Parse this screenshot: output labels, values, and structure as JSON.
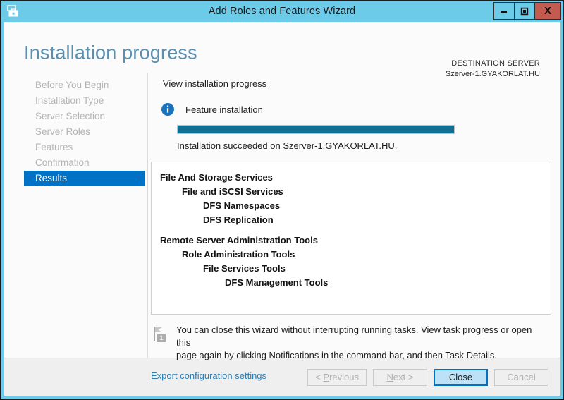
{
  "window": {
    "title": "Add Roles and Features Wizard",
    "app_icon": "server-manager-icon",
    "minimize_label": "minimize-icon",
    "maximize_label": "maximize-icon",
    "close_label": "X",
    "frame_color": "#6CCBE8",
    "close_button_color": "#C45B51"
  },
  "header": {
    "page_title": "Installation progress",
    "destination_label": "DESTINATION SERVER",
    "destination_server": "Szerver-1.GYAKORLAT.HU",
    "title_color": "#5B8FB0"
  },
  "sidebar": {
    "items": [
      {
        "label": "Before You Begin",
        "active": false
      },
      {
        "label": "Installation Type",
        "active": false
      },
      {
        "label": "Server Selection",
        "active": false
      },
      {
        "label": "Server Roles",
        "active": false
      },
      {
        "label": "Features",
        "active": false
      },
      {
        "label": "Confirmation",
        "active": false
      },
      {
        "label": "Results",
        "active": true
      }
    ],
    "active_color": "#0072C6",
    "inactive_color": "#B4B4B4"
  },
  "main": {
    "section_label": "View installation progress",
    "feature_label": "Feature installation",
    "info_icon": "info-icon",
    "progress": {
      "percent": 100,
      "fill_color": "#0F6E92",
      "status_text": "Installation succeeded on Szerver-1.GYAKORLAT.HU."
    },
    "results": [
      {
        "text": "File And Storage Services",
        "level": 0
      },
      {
        "text": "File and iSCSI Services",
        "level": 1
      },
      {
        "text": "DFS Namespaces",
        "level": 2
      },
      {
        "text": "DFS Replication",
        "level": 2
      },
      {
        "text": "",
        "level": 0,
        "spacer": true
      },
      {
        "text": "Remote Server Administration Tools",
        "level": 0
      },
      {
        "text": "Role Administration Tools",
        "level": 1
      },
      {
        "text": "File Services Tools",
        "level": 2
      },
      {
        "text": "DFS Management Tools",
        "level": 3
      }
    ],
    "notice": {
      "icon": "notification-flag-icon",
      "badge": "1",
      "line1": "You can close this wizard without interrupting running tasks. View task progress or open this",
      "line2": "page again by clicking Notifications in the command bar, and then Task Details."
    },
    "export_link": "Export configuration settings",
    "link_color": "#2C7CB0"
  },
  "footer": {
    "buttons": [
      {
        "label": "< Previous",
        "accel": "P",
        "enabled": false
      },
      {
        "label": "Next >",
        "accel": "N",
        "enabled": false
      },
      {
        "label": "Close",
        "accel": "",
        "enabled": true
      },
      {
        "label": "Cancel",
        "accel": "",
        "enabled": false
      }
    ]
  }
}
